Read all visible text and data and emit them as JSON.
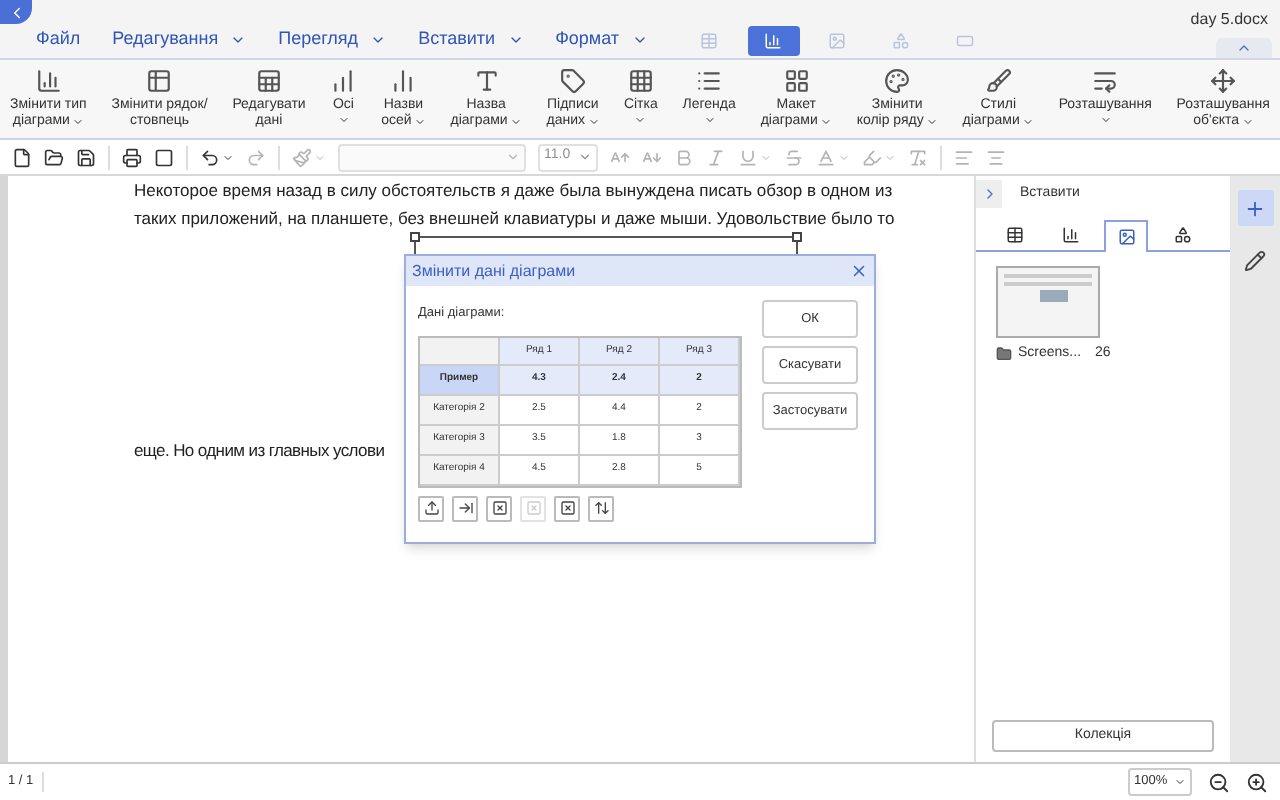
{
  "document_title": "day 5.docx",
  "menus": [
    {
      "label": "Файл",
      "dropdown": false
    },
    {
      "label": "Редагування",
      "dropdown": true
    },
    {
      "label": "Перегляд",
      "dropdown": true
    },
    {
      "label": "Вставити",
      "dropdown": true
    },
    {
      "label": "Формат",
      "dropdown": true
    }
  ],
  "context_tabs": [
    {
      "kind": "table",
      "selected": false
    },
    {
      "kind": "chart",
      "selected": true
    },
    {
      "kind": "image",
      "selected": false
    },
    {
      "kind": "shape",
      "selected": false
    },
    {
      "kind": "textbox",
      "selected": false
    }
  ],
  "ribbon": [
    {
      "kind": "chart-type",
      "lines": [
        "Змінити тип",
        "діаграми"
      ],
      "dropdown": true
    },
    {
      "kind": "row-col",
      "lines": [
        "Змінити рядок/",
        "стовпець"
      ],
      "dropdown": false
    },
    {
      "kind": "edit-data",
      "lines": [
        "Редагувати",
        "дані"
      ],
      "dropdown": false
    },
    {
      "kind": "axes",
      "lines": [
        "Осі"
      ],
      "dropdown": true
    },
    {
      "kind": "axis-titles",
      "lines": [
        "Назви",
        "осей"
      ],
      "dropdown": true
    },
    {
      "kind": "chart-title",
      "lines": [
        "Назва",
        "діаграми"
      ],
      "dropdown": true
    },
    {
      "kind": "data-labels",
      "lines": [
        "Підписи",
        "даних"
      ],
      "dropdown": true
    },
    {
      "kind": "grid",
      "lines": [
        "Сітка"
      ],
      "dropdown": true
    },
    {
      "kind": "legend",
      "lines": [
        "Легенда"
      ],
      "dropdown": true
    },
    {
      "kind": "layout",
      "lines": [
        "Макет",
        "діаграми"
      ],
      "dropdown": true
    },
    {
      "kind": "series-color",
      "lines": [
        "Змінити",
        "колір ряду"
      ],
      "dropdown": true
    },
    {
      "kind": "styles",
      "lines": [
        "Стилі",
        "діаграми"
      ],
      "dropdown": true
    },
    {
      "kind": "wrap",
      "lines": [
        "Розташування"
      ],
      "dropdown": true
    },
    {
      "kind": "position",
      "lines": [
        "Розташування",
        "об'єкта"
      ],
      "dropdown": true
    }
  ],
  "toolbar": [
    {
      "kind": "new",
      "disabled": false
    },
    {
      "kind": "open",
      "disabled": false
    },
    {
      "kind": "save",
      "disabled": false
    },
    {
      "kind": "sep"
    },
    {
      "kind": "print",
      "disabled": false
    },
    {
      "kind": "preview",
      "disabled": false
    },
    {
      "kind": "sep"
    },
    {
      "kind": "undo",
      "disabled": false,
      "dropdown": true
    },
    {
      "kind": "redo",
      "disabled": true
    },
    {
      "kind": "sep"
    },
    {
      "kind": "painter",
      "disabled": true,
      "dropdown": true
    },
    {
      "kind": "font",
      "disabled": true
    },
    {
      "kind": "size",
      "disabled": true,
      "value": "11.0"
    },
    {
      "kind": "grow",
      "disabled": true
    },
    {
      "kind": "shrink",
      "disabled": true
    },
    {
      "kind": "bold",
      "disabled": true
    },
    {
      "kind": "italic",
      "disabled": true
    },
    {
      "kind": "underline",
      "disabled": true,
      "dropdown": true
    },
    {
      "kind": "strike",
      "disabled": true
    },
    {
      "kind": "color",
      "disabled": true,
      "dropdown": true
    },
    {
      "kind": "highlight",
      "disabled": true,
      "dropdown": true
    },
    {
      "kind": "clear",
      "disabled": true
    },
    {
      "kind": "sep"
    },
    {
      "kind": "align-left",
      "disabled": true
    },
    {
      "kind": "align-center",
      "disabled": true
    }
  ],
  "document": {
    "paragraph_lines": [
      "Некоторое время назад в силу обстоятельств я даже была вынуждена писать обзор в одном из",
      "таких приложений, на планшете, без внешней клавиатуры и даже мыши. Удовольствие было то"
    ],
    "line_after_chart": "еще. Но одним из главных услови"
  },
  "dialog": {
    "title": "Змінити дані діаграми",
    "label": "Дані діаграми:",
    "columns": [
      "Ряд 1",
      "Ряд 2",
      "Ряд 3"
    ],
    "rows": [
      {
        "label": "Пример",
        "selected": true,
        "values": [
          "4.3",
          "2.4",
          "2"
        ]
      },
      {
        "label": "Категорія 2",
        "selected": false,
        "values": [
          "2.5",
          "4.4",
          "2"
        ]
      },
      {
        "label": "Категорія 3",
        "selected": false,
        "values": [
          "3.5",
          "1.8",
          "3"
        ]
      },
      {
        "label": "Категорія 4",
        "selected": false,
        "values": [
          "4.5",
          "2.8",
          "5"
        ]
      }
    ],
    "tools": [
      {
        "kind": "import",
        "disabled": false
      },
      {
        "kind": "insert",
        "disabled": false
      },
      {
        "kind": "delete-row",
        "disabled": false
      },
      {
        "kind": "delete-col",
        "disabled": true
      },
      {
        "kind": "delete-all",
        "disabled": false
      },
      {
        "kind": "swap",
        "disabled": false
      }
    ],
    "buttons": [
      "ОК",
      "Скасувати",
      "Застосувати"
    ]
  },
  "side_panel": {
    "title": "Вставити",
    "tabs": [
      {
        "kind": "table",
        "selected": false
      },
      {
        "kind": "chart",
        "selected": false
      },
      {
        "kind": "image",
        "selected": true
      },
      {
        "kind": "shape",
        "selected": false
      }
    ],
    "items": [
      {
        "name": "Screens...",
        "count": "26"
      }
    ],
    "button": "Колекція"
  },
  "side_strip": [
    {
      "kind": "add",
      "selected": true
    },
    {
      "kind": "edit",
      "selected": false
    }
  ],
  "status": {
    "page": "1 / 1",
    "zoom": "100%"
  }
}
